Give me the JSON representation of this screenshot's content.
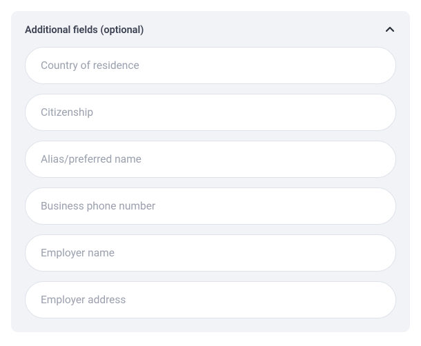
{
  "panel": {
    "title": "Additional fields (optional)",
    "expanded": true
  },
  "fields": [
    {
      "id": "country-of-residence",
      "placeholder": "Country of residence",
      "value": ""
    },
    {
      "id": "citizenship",
      "placeholder": "Citizenship",
      "value": ""
    },
    {
      "id": "alias",
      "placeholder": "Alias/preferred name",
      "value": ""
    },
    {
      "id": "business-phone",
      "placeholder": "Business phone number",
      "value": ""
    },
    {
      "id": "employer-name",
      "placeholder": "Employer name",
      "value": ""
    },
    {
      "id": "employer-address",
      "placeholder": "Employer address",
      "value": ""
    }
  ]
}
